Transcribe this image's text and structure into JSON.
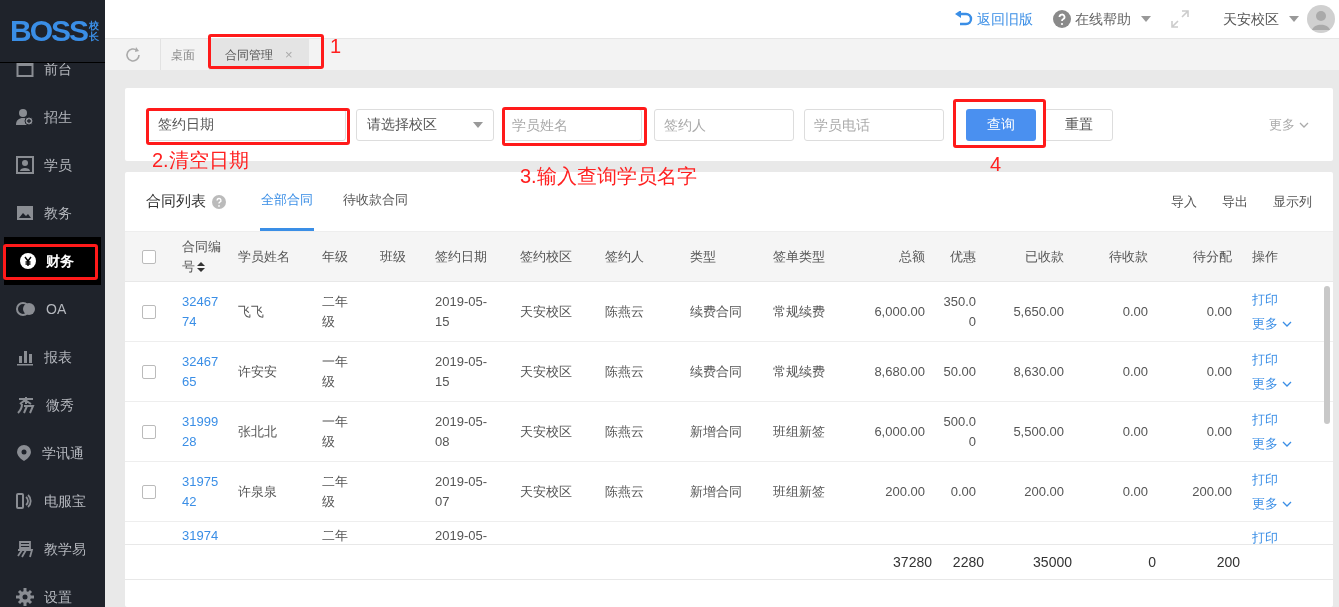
{
  "logo": {
    "text": "BOSS",
    "badge": "校长"
  },
  "header": {
    "back_link": "返回旧版",
    "help": "在线帮助",
    "campus": "天安校区"
  },
  "sidebar": {
    "items": [
      {
        "label": "前台",
        "selected": false
      },
      {
        "label": "招生",
        "selected": false
      },
      {
        "label": "学员",
        "selected": false
      },
      {
        "label": "教务",
        "selected": false
      },
      {
        "label": "财务",
        "selected": true
      },
      {
        "label": "OA",
        "selected": false
      },
      {
        "label": "报表",
        "selected": false
      },
      {
        "label": "微秀",
        "selected": false
      },
      {
        "label": "学讯通",
        "selected": false
      },
      {
        "label": "电服宝",
        "selected": false
      },
      {
        "label": "教学易",
        "selected": false
      },
      {
        "label": "设置",
        "selected": false
      }
    ]
  },
  "tabs": [
    {
      "label": "桌面",
      "selected": false
    },
    {
      "label": "合同管理",
      "selected": true,
      "close": "×"
    }
  ],
  "filters": {
    "date": {
      "value": "签约日期"
    },
    "campus_select": {
      "placeholder": "请选择校区"
    },
    "student_name": {
      "placeholder": "学员姓名"
    },
    "signer": {
      "placeholder": "签约人"
    },
    "phone": {
      "placeholder": "学员电话"
    },
    "query_button": "查询",
    "reset_button": "重置",
    "more": "更多"
  },
  "list": {
    "title": "合同列表",
    "tabs": [
      {
        "label": "全部合同",
        "selected": true
      },
      {
        "label": "待收款合同",
        "selected": false
      }
    ],
    "actions": [
      "导入",
      "导出",
      "显示列"
    ]
  },
  "table": {
    "select_all_checked": false,
    "columns": [
      "合同编号",
      "学员姓名",
      "年级",
      "班级",
      "签约日期",
      "签约校区",
      "签约人",
      "类型",
      "签单类型",
      "总额",
      "优惠",
      "已收款",
      "待收款",
      "待分配",
      "操作"
    ],
    "rows": [
      {
        "checked": false,
        "cells": [
          "3246774",
          "飞飞",
          "二年级",
          "",
          "2019-05-15",
          "天安校区",
          "陈燕云",
          "续费合同",
          "常规续费",
          "6,000.00",
          "350.00",
          "5,650.00",
          "0.00",
          "0.00"
        ],
        "print": "打印",
        "more": "更多"
      },
      {
        "checked": false,
        "cells": [
          "3246765",
          "许安安",
          "一年级",
          "",
          "2019-05-15",
          "天安校区",
          "陈燕云",
          "续费合同",
          "常规续费",
          "8,680.00",
          "50.00",
          "8,630.00",
          "0.00",
          "0.00"
        ],
        "print": "打印",
        "more": "更多"
      },
      {
        "checked": false,
        "cells": [
          "3199928",
          "张北北",
          "一年级",
          "",
          "2019-05-08",
          "天安校区",
          "陈燕云",
          "新增合同",
          "班组新签",
          "6,000.00",
          "500.00",
          "5,500.00",
          "0.00",
          "0.00"
        ],
        "print": "打印",
        "more": "更多"
      },
      {
        "checked": false,
        "cells": [
          "3197542",
          "许泉泉",
          "二年级",
          "",
          "2019-05-07",
          "天安校区",
          "陈燕云",
          "新增合同",
          "班组新签",
          "200.00",
          "0.00",
          "200.00",
          "0.00",
          "200.00"
        ],
        "print": "打印",
        "more": "更多"
      }
    ],
    "partial_row": {
      "cells": [
        "31974",
        "",
        "二年",
        "",
        "2019-05-",
        "",
        "",
        "",
        "",
        "",
        "",
        "",
        "",
        ""
      ],
      "print": "打印"
    },
    "totals": [
      "37280",
      "2280",
      "35000",
      "0",
      "200"
    ]
  },
  "annotations": [
    {
      "label": "1"
    },
    {
      "label": "2.清空日期"
    },
    {
      "label": "3.输入查询学员名字"
    },
    {
      "label": "4"
    }
  ]
}
